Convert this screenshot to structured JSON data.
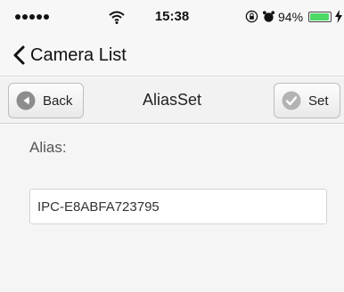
{
  "status_bar": {
    "time": "15:38",
    "battery_percent": "94%",
    "battery_level": 0.94,
    "battery_color": "#4cd964",
    "icons": [
      "signal-dots-icon",
      "wifi-icon",
      "rotation-lock-icon",
      "alarm-icon",
      "battery-icon",
      "charging-icon"
    ]
  },
  "nav": {
    "back_label": "Camera List",
    "back_icon": "chevron-left-icon"
  },
  "toolbar": {
    "title": "AliasSet",
    "back_button": {
      "label": "Back",
      "icon": "back-arrow-circle-icon"
    },
    "set_button": {
      "label": "Set",
      "icon": "checkmark-circle-icon"
    }
  },
  "form": {
    "alias_label": "Alias:",
    "alias_value": "IPC-E8ABFA723795"
  }
}
